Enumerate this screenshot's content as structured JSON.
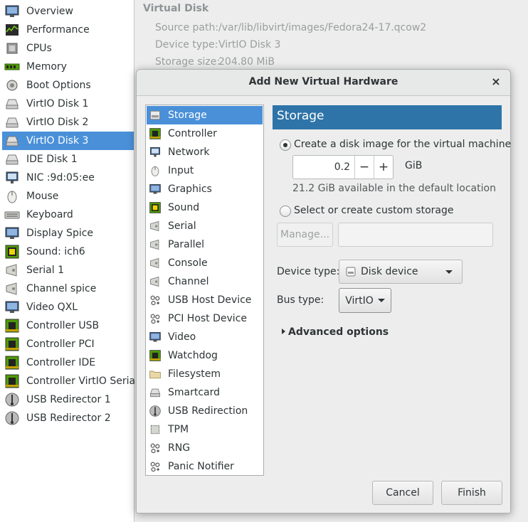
{
  "hardware_list": {
    "items": [
      {
        "label": "Overview",
        "icon": "overview-icon"
      },
      {
        "label": "Performance",
        "icon": "performance-icon"
      },
      {
        "label": "CPUs",
        "icon": "cpu-icon"
      },
      {
        "label": "Memory",
        "icon": "memory-icon"
      },
      {
        "label": "Boot Options",
        "icon": "boot-options-icon"
      },
      {
        "label": "VirtIO Disk 1",
        "icon": "disk-icon"
      },
      {
        "label": "VirtIO Disk 2",
        "icon": "disk-icon"
      },
      {
        "label": "VirtIO Disk 3",
        "icon": "disk-icon",
        "selected": true
      },
      {
        "label": "IDE Disk 1",
        "icon": "disk-icon"
      },
      {
        "label": "NIC :9d:05:ee",
        "icon": "network-icon"
      },
      {
        "label": "Mouse",
        "icon": "mouse-icon"
      },
      {
        "label": "Keyboard",
        "icon": "keyboard-icon"
      },
      {
        "label": "Display Spice",
        "icon": "display-icon"
      },
      {
        "label": "Sound: ich6",
        "icon": "sound-icon"
      },
      {
        "label": "Serial 1",
        "icon": "serial-icon"
      },
      {
        "label": "Channel spice",
        "icon": "serial-icon"
      },
      {
        "label": "Video QXL",
        "icon": "display-icon"
      },
      {
        "label": "Controller USB",
        "icon": "controller-icon"
      },
      {
        "label": "Controller PCI",
        "icon": "controller-icon"
      },
      {
        "label": "Controller IDE",
        "icon": "controller-icon"
      },
      {
        "label": "Controller VirtIO Serial",
        "icon": "controller-icon"
      },
      {
        "label": "USB Redirector 1",
        "icon": "usb-redirect-icon"
      },
      {
        "label": "USB Redirector 2",
        "icon": "usb-redirect-icon"
      }
    ]
  },
  "details": {
    "title": "Virtual Disk",
    "source_path_label": "Source path:",
    "source_path": "/var/lib/libvirt/images/Fedora24-17.qcow2",
    "device_type_label": "Device type:",
    "device_type": "VirtIO Disk 3",
    "storage_size_label": "Storage size:",
    "storage_size": "204.80 MiB"
  },
  "dialog": {
    "title": "Add New Virtual Hardware",
    "close_glyph": "×",
    "device_types": [
      {
        "label": "Storage",
        "icon": "storage-icon",
        "selected": true
      },
      {
        "label": "Controller",
        "icon": "controller-icon"
      },
      {
        "label": "Network",
        "icon": "network-icon"
      },
      {
        "label": "Input",
        "icon": "mouse-icon"
      },
      {
        "label": "Graphics",
        "icon": "display-icon"
      },
      {
        "label": "Sound",
        "icon": "sound-icon"
      },
      {
        "label": "Serial",
        "icon": "serial-icon"
      },
      {
        "label": "Parallel",
        "icon": "serial-icon"
      },
      {
        "label": "Console",
        "icon": "serial-icon"
      },
      {
        "label": "Channel",
        "icon": "serial-icon"
      },
      {
        "label": "USB Host Device",
        "icon": "usb-host-icon"
      },
      {
        "label": "PCI Host Device",
        "icon": "usb-host-icon"
      },
      {
        "label": "Video",
        "icon": "display-icon"
      },
      {
        "label": "Watchdog",
        "icon": "controller-icon"
      },
      {
        "label": "Filesystem",
        "icon": "folder-icon"
      },
      {
        "label": "Smartcard",
        "icon": "disk-icon"
      },
      {
        "label": "USB Redirection",
        "icon": "usb-redirect-icon"
      },
      {
        "label": "TPM",
        "icon": "tpm-icon"
      },
      {
        "label": "RNG",
        "icon": "usb-host-icon"
      },
      {
        "label": "Panic Notifier",
        "icon": "usb-host-icon"
      }
    ],
    "panel_title": "Storage",
    "create_option_label": "Create a disk image for the virtual machine",
    "size_value": "0.2",
    "size_unit": "GiB",
    "decrement_glyph": "−",
    "increment_glyph": "+",
    "available_text": "21.2 GiB available in the default location",
    "custom_option_label": "Select or create custom storage",
    "manage_label": "Manage...",
    "custom_path_value": "",
    "device_type_label": "Device type:",
    "device_type_value": "Disk device",
    "bus_type_label": "Bus type:",
    "bus_type_value": "VirtIO",
    "advanced_label": "Advanced options",
    "cancel_label": "Cancel",
    "finish_label": "Finish"
  },
  "colors": {
    "selection": "#4a90d9",
    "panel_header": "#2e74a8",
    "window_bg": "#ededed"
  }
}
